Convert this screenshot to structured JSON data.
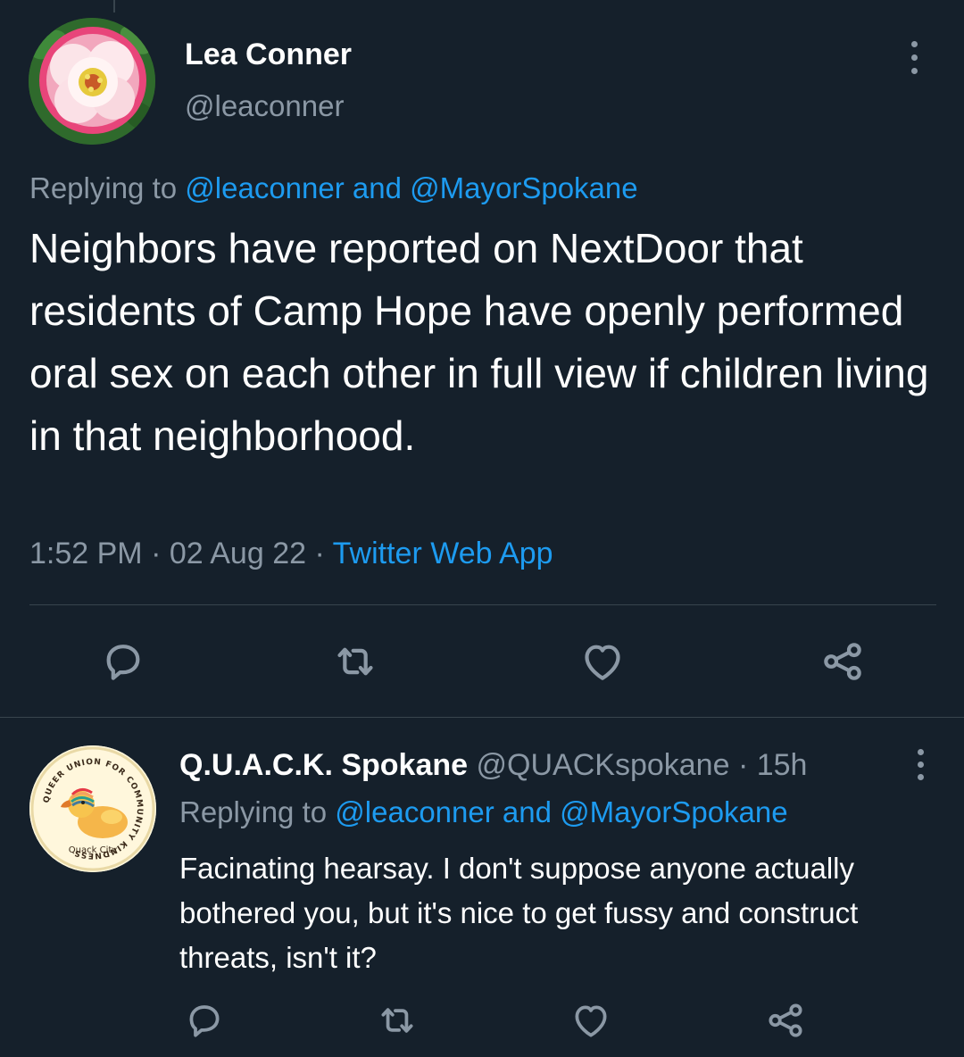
{
  "main_tweet": {
    "author_name": "Lea Conner",
    "author_handle": "@leaconner",
    "replying_prefix": "Replying to",
    "replying_handle_1": "@leaconner",
    "replying_and": "and",
    "replying_handle_2": "@MayorSpokane",
    "text": "Neighbors have reported on NextDoor that residents of Camp Hope have openly performed oral sex on each other in full view if children living in that neighborhood.",
    "time": "1:52 PM",
    "date": "02 Aug 22",
    "source": "Twitter Web App",
    "separator": "·",
    "avatar_icon": "rose-flower-avatar",
    "actions": [
      "reply-icon",
      "retweet-icon",
      "like-icon",
      "share-icon"
    ]
  },
  "reply_tweet": {
    "author_name": "Q.U.A.C.K. Spokane",
    "author_handle": "@QUACKspokane",
    "age": "15h",
    "separator": "·",
    "replying_prefix": "Replying to",
    "replying_handle_1": "@leaconner",
    "replying_and": "and",
    "replying_handle_2": "@MayorSpokane",
    "text": "Facinating hearsay. I don't suppose anyone actually bothered you, but it's nice to get fussy and construct threats, isn't it?",
    "avatar": {
      "ring_text": "QUEER UNION FOR COMMUNITY KINDNESS",
      "bottom_text": "Quack City"
    },
    "actions": [
      "reply-icon",
      "retweet-icon",
      "like-icon",
      "share-icon"
    ]
  },
  "colors": {
    "background": "#15202b",
    "text_primary": "#ffffff",
    "text_secondary": "#8b98a5",
    "link": "#1d9bf0",
    "divider": "#38444d"
  }
}
